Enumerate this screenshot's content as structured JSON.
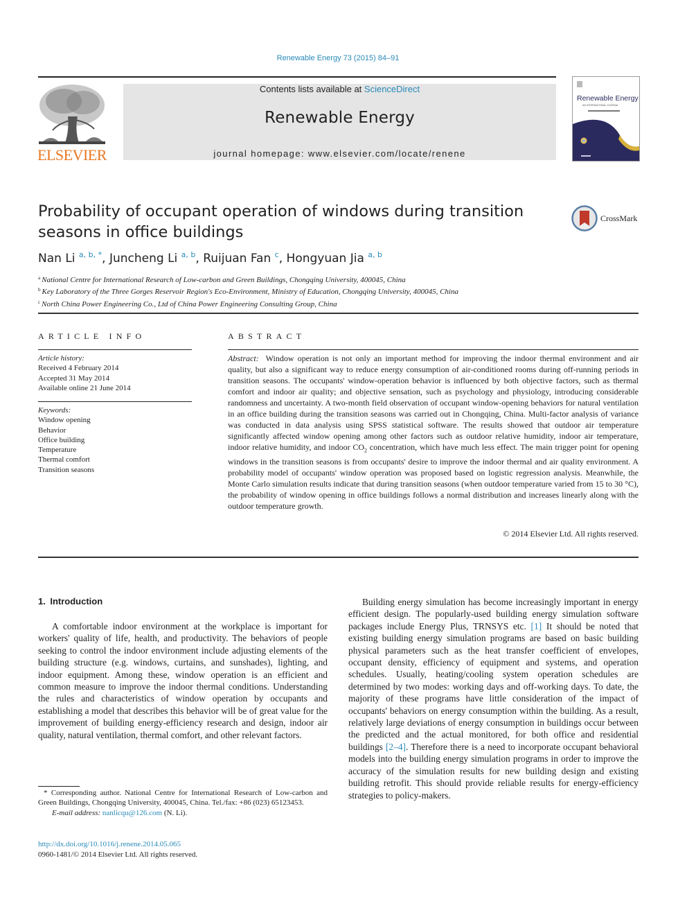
{
  "journal_ref": "Renewable Energy 73 (2015) 84–91",
  "masthead": {
    "contents_prefix": "Contents lists available at ",
    "contents_link": "ScienceDirect",
    "journal_title": "Renewable Energy",
    "homepage": "journal homepage: www.elsevier.com/locate/renene",
    "publisher_logo_text": "ELSEVIER",
    "cover_title": "Renewable Energy",
    "cover_subtitle": "AN INTERNATIONAL JOURNAL"
  },
  "colors": {
    "link": "#2a8ab8",
    "publisher_orange": "#e87722",
    "masthead_bg": "#e5e5e5",
    "cover_navy": "#2b2a5e",
    "cover_gold": "#d8b23a",
    "crossmark_red": "#c0392b"
  },
  "article": {
    "title": "Probability of occupant operation of windows during transition seasons in office buildings",
    "crossmark_label": "CrossMark",
    "authors": [
      {
        "name": "Nan Li",
        "sup": "a, b, *"
      },
      {
        "name": "Juncheng Li",
        "sup": "a, b"
      },
      {
        "name": "Ruijuan Fan",
        "sup": "c"
      },
      {
        "name": "Hongyuan Jia",
        "sup": "a, b"
      }
    ],
    "affiliations": [
      {
        "key": "a",
        "text": "National Centre for International Research of Low-carbon and Green Buildings, Chongqing University, 400045, China"
      },
      {
        "key": "b",
        "text": "Key Laboratory of the Three Gorges Reservoir Region's Eco-Environment, Ministry of Education, Chongqing University, 400045, China"
      },
      {
        "key": "c",
        "text": "North China Power Engineering Co., Ltd of China Power Engineering Consulting Group, China"
      }
    ]
  },
  "article_info": {
    "heading": "ARTICLE INFO",
    "history_label": "Article history:",
    "history": [
      "Received 4 February 2014",
      "Accepted 31 May 2014",
      "Available online 21 June 2014"
    ],
    "keywords_label": "Keywords:",
    "keywords": [
      "Window opening",
      "Behavior",
      "Office building",
      "Temperature",
      "Thermal comfort",
      "Transition seasons"
    ]
  },
  "abstract": {
    "heading": "ABSTRACT",
    "label": "Abstract:",
    "text_before_sub": "Window operation is not only an important method for improving the indoor thermal environment and air quality, but also a significant way to reduce energy consumption of air-conditioned rooms during off-running periods in transition seasons. The occupants' window-operation behavior is influenced by both objective factors, such as thermal comfort and indoor air quality; and objective sensation, such as psychology and physiology, introducing considerable randomness and uncertainty. A two-month field observation of occupant window-opening behaviors for natural ventilation in an office building during the transition seasons was carried out in Chongqing, China. Multi-factor analysis of variance was conducted in data analysis using SPSS statistical software. The results showed that outdoor air temperature significantly affected window opening among other factors such as outdoor relative humidity, indoor air temperature, indoor relative humidity, and indoor CO",
    "subscript": "2",
    "text_after_sub": " concentration, which have much less effect. The main trigger point for opening windows in the transition seasons is from occupants' desire to improve the indoor thermal and air quality environment. A probability model of occupants' window operation was proposed based on logistic regression analysis. Meanwhile, the Monte Carlo simulation results indicate that during transition seasons (when outdoor temperature varied from 15 to 30 °C), the probability of window opening in office buildings follows a normal distribution and increases linearly along with the outdoor temperature growth.",
    "copyright": "© 2014 Elsevier Ltd. All rights reserved."
  },
  "introduction": {
    "heading": "1. Introduction",
    "para1": "A comfortable indoor environment at the workplace is important for workers' quality of life, health, and productivity. The behaviors of people seeking to control the indoor environment include adjusting elements of the building structure (e.g. windows, curtains, and sunshades), lighting, and indoor equipment. Among these, window operation is an efficient and common measure to improve the indoor thermal conditions. Understanding the rules and characteristics of window operation by occupants and establishing a model that describes this behavior will be of great value for the improvement of building energy-efficiency research and design, indoor air quality, natural ventilation, thermal comfort, and other relevant factors.",
    "para2_a": "Building energy simulation has become increasingly important in energy efficient design. The popularly-used building energy simulation software packages include Energy Plus, TRNSYS etc. ",
    "ref1": "[1]",
    "para2_b": " It should be noted that existing building energy simulation programs are based on basic building physical parameters such as the heat transfer coefficient of envelopes, occupant density, efficiency of equipment and systems, and operation schedules. Usually, heating/cooling system operation schedules are determined by two modes: working days and off-working days. To date, the majority of these programs have little consideration of the impact of occupants' behaviors on energy consumption within the building. As a result, relatively large deviations of energy consumption in buildings occur between the predicted and the actual monitored, for both office and residential buildings ",
    "ref2": "[2–4]",
    "para2_c": ". Therefore there is a need to incorporate occupant behavioral models into the building energy simulation programs in order to improve the accuracy of the simulation results for new building design and existing building retrofit. This should provide reliable results for energy-efficiency strategies to policy-makers."
  },
  "footnote": {
    "corresponding": "* Corresponding author. National Centre for International Research of Low-carbon and Green Buildings, Chongqing University, 400045, China. Tel./fax: +86 (023) 65123453.",
    "email_label": "E-mail address:",
    "email": "nanlicqu@126.com",
    "email_suffix": " (N. Li).",
    "doi": "http://dx.doi.org/10.1016/j.renene.2014.05.065",
    "issn": "0960-1481/© 2014 Elsevier Ltd. All rights reserved."
  }
}
